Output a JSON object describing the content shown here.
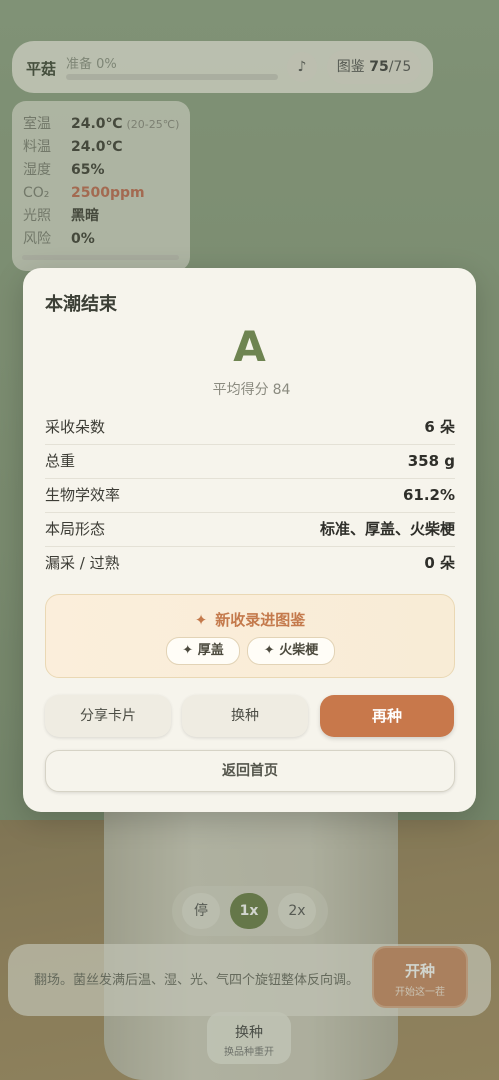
{
  "topbar": {
    "name": "平菇",
    "prep_label": "准备 0%",
    "prep_progress": 0,
    "music_icon": "♪",
    "dex_label": "图鉴",
    "dex_current": "75",
    "dex_total": "/75"
  },
  "stats": {
    "rows": [
      {
        "label": "室温",
        "value": "24.0℃",
        "extra": "(20-25℃)"
      },
      {
        "label": "料温",
        "value": "24.0℃"
      },
      {
        "label": "湿度",
        "value": "65%"
      },
      {
        "label": "CO₂",
        "value": "2500ppm",
        "status": "warning"
      },
      {
        "label": "光照",
        "value": "黑暗"
      },
      {
        "label": "风险",
        "value": "0%"
      }
    ],
    "warning_color": "#c06b52"
  },
  "modal": {
    "title": "本潮结束",
    "grade": "A",
    "avg_label": "平均得分",
    "avg_value": "84",
    "rows": [
      {
        "label": "采收朵数",
        "value": "6 朵"
      },
      {
        "label": "总重",
        "value": "358 g"
      },
      {
        "label": "生物学效率",
        "value": "61.2%"
      },
      {
        "label": "本局形态",
        "value": "标准、厚盖、火柴梗"
      },
      {
        "label": "漏采 / 过熟",
        "value": "0 朵"
      }
    ],
    "new_entries": {
      "heading_star": "✦",
      "heading": "新收录进图鉴",
      "chips": [
        "✦ 厚盖",
        "✦ 火柴梗"
      ]
    },
    "buttons": {
      "share": "分享卡片",
      "swap": "换种",
      "replant": "再种",
      "home": "返回首页"
    },
    "accent_color": "#c8784b",
    "grade_color": "#6e8451"
  },
  "speed": {
    "pause": "停",
    "x1": "1x",
    "x2": "2x",
    "active": "1x"
  },
  "hint": {
    "text": "翻场。菌丝发满后温、湿、光、气四个旋钮整体反向调。"
  },
  "start_button": {
    "title": "开种",
    "subtitle": "开始这一茬"
  },
  "swap_button": {
    "title": "换种",
    "subtitle": "换品种重开"
  }
}
